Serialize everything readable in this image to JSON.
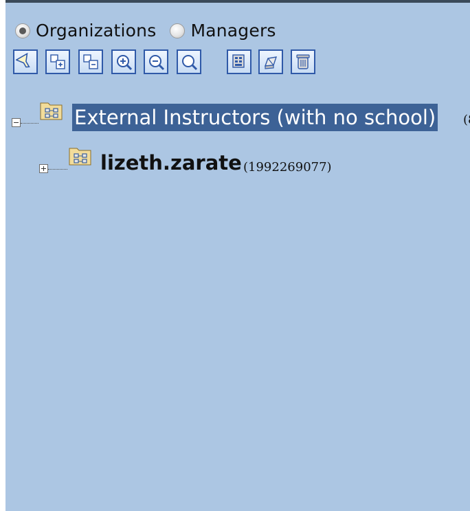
{
  "view_toggle": {
    "options": [
      {
        "label": "Organizations",
        "selected": true
      },
      {
        "label": "Managers",
        "selected": false
      }
    ]
  },
  "toolbar": {
    "buttons": [
      {
        "icon": "filter-icon"
      },
      {
        "icon": "expand-all-icon"
      },
      {
        "icon": "collapse-all-icon"
      },
      {
        "icon": "zoom-in-icon"
      },
      {
        "icon": "zoom-out-icon"
      },
      {
        "icon": "search-icon"
      },
      {
        "icon": "organization-icon"
      },
      {
        "icon": "edit-icon"
      },
      {
        "icon": "delete-icon"
      }
    ]
  },
  "tree": {
    "root": {
      "label": "External Instructors (with no school)",
      "count": "(8",
      "expanded": true,
      "selected": true
    },
    "child": {
      "label": "lizeth.zarate",
      "count": "(1992269077)",
      "expanded": false
    }
  },
  "colors": {
    "panel_background": "#acc6e3",
    "selection": "#3d6296",
    "button_border": "#2f59a8"
  }
}
